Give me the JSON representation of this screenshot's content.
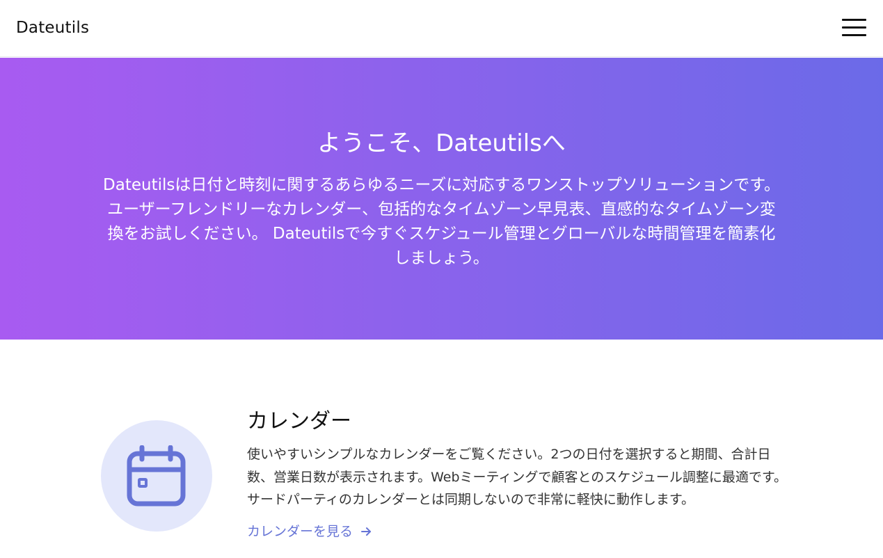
{
  "navbar": {
    "brand": "Dateutils",
    "menu_icon": "hamburger-menu-icon"
  },
  "hero": {
    "title": "ようこそ、Dateutilsへ",
    "description": "Dateutilsは日付と時刻に関するあらゆるニーズに対応するワンストップソリューションです。 ユーザーフレンドリーなカレンダー、包括的なタイムゾーン早見表、直感的なタイムゾーン変換をお試しください。 Dateutilsで今すぐスケジュール管理とグローバルな時間管理を簡素化しましょう。",
    "gradient_start": "#a85bf1",
    "gradient_end": "#6b6ae8"
  },
  "features": [
    {
      "icon": "calendar-icon",
      "title": "カレンダー",
      "description": "使いやすいシンプルなカレンダーをご覧ください。2つの日付を選択すると期間、合計日数、営業日数が表示されます。Webミーティングで顧客とのスケジュール調整に最適です。サードパーティのカレンダーとは同期しないので非常に軽快に動作します。",
      "link_label": "カレンダーを見る",
      "link_icon": "arrow-right-icon"
    }
  ],
  "colors": {
    "accent": "#6674d6",
    "icon_bg": "#e3e7fb"
  }
}
